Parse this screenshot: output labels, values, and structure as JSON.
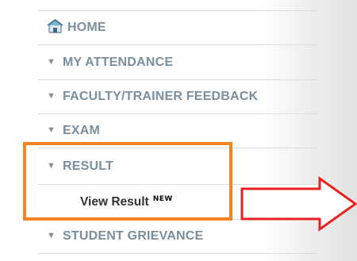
{
  "menu": {
    "home_label": "HOME",
    "items": [
      {
        "label": "MY ATTENDANCE"
      },
      {
        "label": "FACULTY/TRAINER FEEDBACK"
      },
      {
        "label": "EXAM"
      },
      {
        "label": "RESULT"
      }
    ],
    "submenu": {
      "label": "View Result",
      "badge": "NEW"
    },
    "last_item": {
      "label": "STUDENT GRIEVANCE"
    }
  },
  "icons": {
    "home": "home-icon",
    "arrow": "triangle-down-icon",
    "pointer": "red-arrow-icon"
  },
  "colors": {
    "menu_text": "#7a8e9c",
    "submenu_text": "#333333",
    "highlight": "#f58223",
    "arrow": "#e82020"
  }
}
